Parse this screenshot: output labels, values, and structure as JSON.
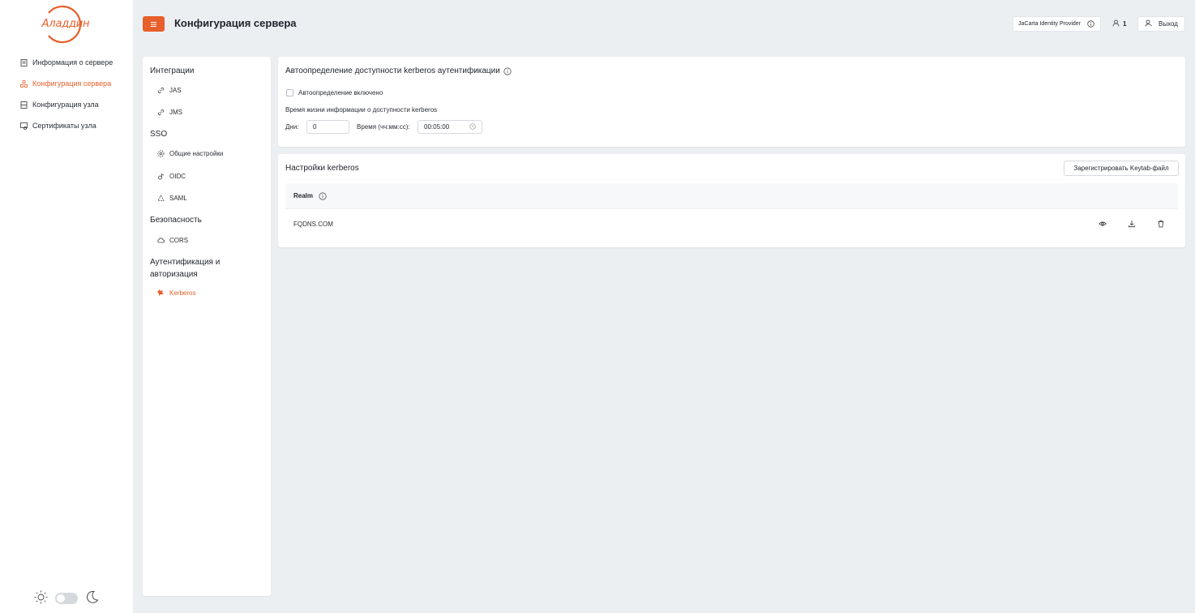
{
  "brand": {
    "logo_text": "Аладдин",
    "accent": "#e75f2a"
  },
  "sidebar": {
    "items": [
      {
        "label": "Информация о сервере",
        "icon": "server-info-icon",
        "active": false
      },
      {
        "label": "Конфигурация сервера",
        "icon": "server-config-icon",
        "active": true
      },
      {
        "label": "Конфигурация узла",
        "icon": "node-config-icon",
        "active": false
      },
      {
        "label": "Сертификаты узла",
        "icon": "certificate-icon",
        "active": false
      }
    ],
    "theme": {
      "light_icon": "sun-icon",
      "dark_icon": "moon-icon"
    }
  },
  "header": {
    "menu_icon": "hamburger-icon",
    "title": "Конфигурация сервера",
    "provider": "JaCarta Identity Provider",
    "users_count": "1",
    "logout": "Выход"
  },
  "settings_menu": {
    "group_integrations": "Интеграции",
    "jas": "JAS",
    "jms": "JMS",
    "group_sso": "SSO",
    "general": "Общие настройки",
    "oidc": "OIDC",
    "saml": "SAML",
    "group_security": "Безопасность",
    "cors": "CORS",
    "group_auth_line1": "Аутентификация и",
    "group_auth_line2": "авторизация",
    "kerberos": "Kerberos"
  },
  "autodetect": {
    "title": "Автоопределение доступности kerberos аутентификации",
    "checkbox_label": "Автоопределение включено",
    "checkbox_checked": false,
    "lifetime_label": "Время жизни информации о доступности kerberos",
    "days_label": "Дни:",
    "days_value": "0",
    "time_label": "Время (чч:мм:сс):",
    "time_value": "00:05:00"
  },
  "kerberos": {
    "title": "Настройки kerberos",
    "register_button": "Зарегистрировать Keytab-файл",
    "column_realm": "Realm",
    "rows": [
      {
        "realm": "FQDNS.COM"
      }
    ]
  }
}
